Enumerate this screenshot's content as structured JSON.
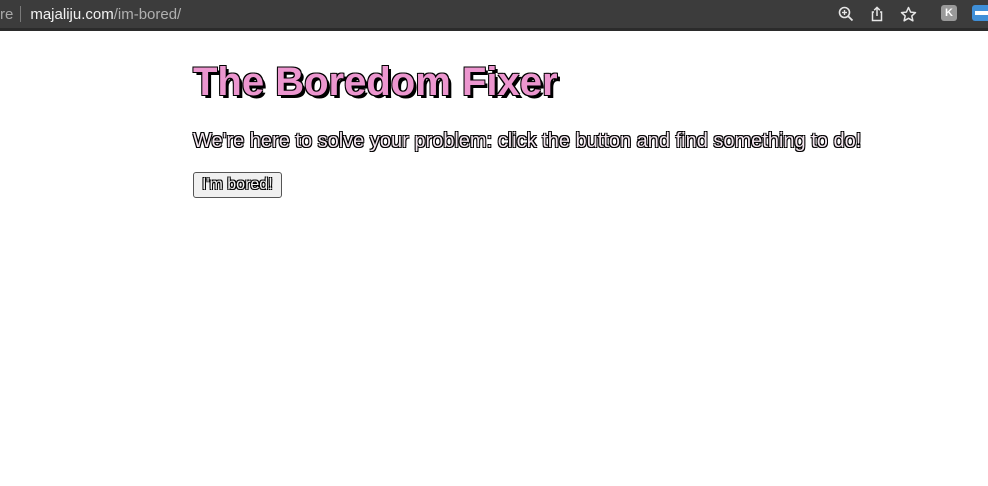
{
  "browser": {
    "security_label": "re",
    "url_domain": "majaliju.com",
    "url_path": "/im-bored/",
    "icons": [
      "zoom-icon",
      "share-icon",
      "star-icon",
      "extension-k-icon",
      "extension-blue-icon"
    ],
    "extension_k_label": "K",
    "bar_color": "#3c3c3c"
  },
  "page": {
    "title": "The Boredom Fixer",
    "subtitle": "We're here to solve your problem: click the button and find something to do!",
    "button_label": "I'm bored!",
    "title_color": "#ec96cf"
  }
}
